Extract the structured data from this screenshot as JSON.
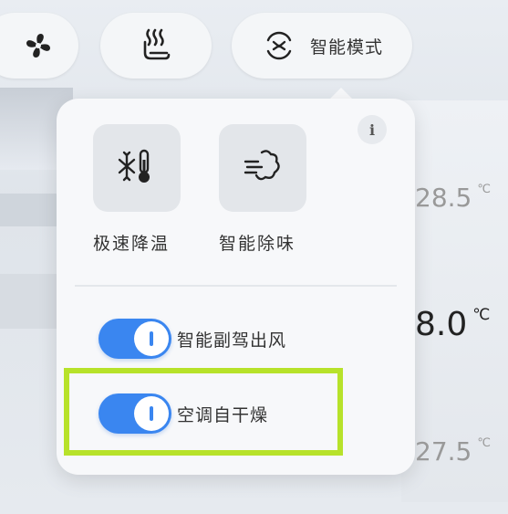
{
  "top_bar": {
    "fan_icon": "fan-icon",
    "seat_heat_icon": "seat-heat-icon",
    "smart_mode_icon": "smart-mode-icon",
    "smart_mode_label": "智能模式"
  },
  "popup": {
    "info_label": "i",
    "modes": [
      {
        "icon": "thermometer-snowflake-icon",
        "label": "极速降温"
      },
      {
        "icon": "odor-removal-icon",
        "label": "智能除味"
      }
    ],
    "toggles": [
      {
        "label": "智能副驾出风",
        "on": true
      },
      {
        "label": "空调自干燥",
        "on": true
      }
    ]
  },
  "temperature_scale": {
    "upper": {
      "value": "28.5",
      "unit": "℃"
    },
    "current": {
      "value": "8.0",
      "unit": "℃"
    },
    "lower": {
      "value": "27.5",
      "unit": "℃"
    }
  },
  "colors": {
    "accent_blue": "#3a86f0",
    "highlight_green": "#b7e22a",
    "popup_bg": "#f7f8fa"
  }
}
